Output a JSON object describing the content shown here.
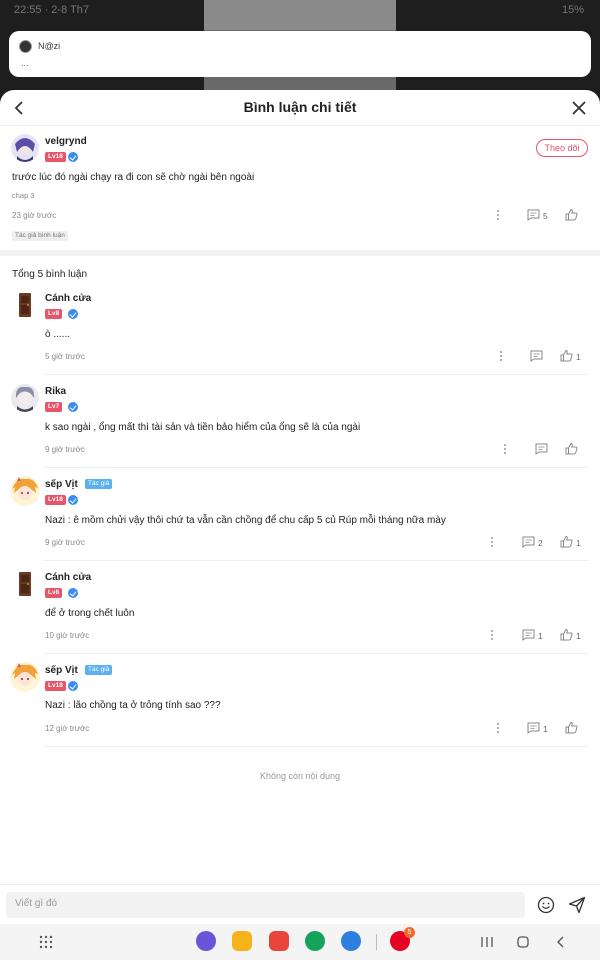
{
  "status": {
    "time": "22:55 · 2-8 Th7",
    "right": "15%"
  },
  "notification": {
    "name": "N@zi",
    "text": "..."
  },
  "header": {
    "title": "Bình luận chi tiết"
  },
  "main": {
    "username": "velgrynd",
    "level": "Lv18",
    "follow_label": "Theo dõi",
    "content": "trước lúc đó ngài chạy ra đi con sẽ chờ ngài bên ngoài",
    "chapter": "chap 3",
    "time": "23 giờ trước",
    "reply_count": "5",
    "author_tag": "Tác giả bình luận"
  },
  "total_label": "Tổng 5 bình luận",
  "replies": [
    {
      "username": "Cánh cửa",
      "level": "Lv8",
      "author_tag": "",
      "content": "ò ......",
      "time": "5 giờ trước",
      "replies": "",
      "likes": "1"
    },
    {
      "username": "Rika",
      "level": "Lv7",
      "author_tag": "",
      "content": "k sao ngài , ổng mất thì tài sản và tiền bảo hiểm của ổng sẽ là của ngài",
      "time": "9 giờ trước",
      "replies": "",
      "likes": ""
    },
    {
      "username": "sếp Vịt",
      "level": "Lv18",
      "author_tag": "Tác giả",
      "content": "Nazi : ê mồm chửi vậy thôi chứ ta vẫn cần chồng để chu cấp 5 củ Rúp mỗi tháng nữa mày",
      "time": "9 giờ trước",
      "replies": "2",
      "likes": "1"
    },
    {
      "username": "Cánh cửa",
      "level": "Lv8",
      "author_tag": "",
      "content": "để ở trong chết luôn",
      "time": "10 giờ trước",
      "replies": "1",
      "likes": "1"
    },
    {
      "username": "sếp Vịt",
      "level": "Lv18",
      "author_tag": "Tác giả",
      "content": "Nazi : lão chồng ta ở trỏng tính sao ???",
      "time": "12 giờ trước",
      "replies": "1",
      "likes": ""
    }
  ],
  "end_label": "Không còn nội dung",
  "input": {
    "placeholder": "Viết gì đó"
  },
  "dock": {
    "pinterest_badge": "5"
  },
  "colors": {
    "accent": "#e85468",
    "blue": "#3a8cf0"
  }
}
